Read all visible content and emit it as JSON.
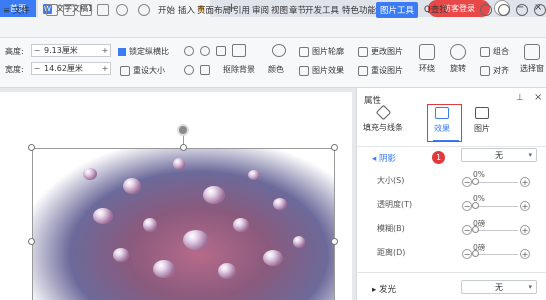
{
  "tabs": {
    "home": "首页",
    "doc_icon": "W",
    "doc": "文字文稿1",
    "new": "+",
    "login": "访客登录",
    "avatar": "avatar-icon"
  },
  "window": {
    "minimize": "−",
    "close": "×"
  },
  "menu": {
    "file": "≡ 文件",
    "items": [
      "开始",
      "插入",
      "页面布局",
      "引用",
      "审阅",
      "视图",
      "章节",
      "开发工具",
      "特色功能"
    ],
    "active": "图片工具",
    "search": "Q查找"
  },
  "ribbon": {
    "height_label": "高度:",
    "height_value": "9.13厘米",
    "width_label": "宽度:",
    "width_value": "14.62厘米",
    "lock_ratio": "锁定纵横比",
    "reset_size": "重设大小",
    "remove_bg": "抠除背景",
    "color": "颜色",
    "outline": "图片轮廓",
    "effects": "图片效果",
    "change_pic": "更改图片",
    "reset_pic": "重设图片",
    "wrap": "环绕",
    "rotate": "旋转",
    "group": "组合",
    "align": "对齐",
    "select": "选择窗",
    "minus": "−",
    "plus": "+"
  },
  "panel": {
    "title": "属性",
    "tabs": [
      "填充与线条",
      "效果",
      "图片"
    ],
    "active_tab": "效果",
    "callout_number": "1",
    "section_shadow": "阴影",
    "shadow_value": "无",
    "rows": [
      {
        "label": "大小(S)",
        "value": "0%"
      },
      {
        "label": "透明度(T)",
        "value": "0%"
      },
      {
        "label": "模糊(B)",
        "value": "0磅"
      },
      {
        "label": "距离(D)",
        "value": "0磅"
      }
    ],
    "section_glow": "发光",
    "glow_value": "无"
  }
}
